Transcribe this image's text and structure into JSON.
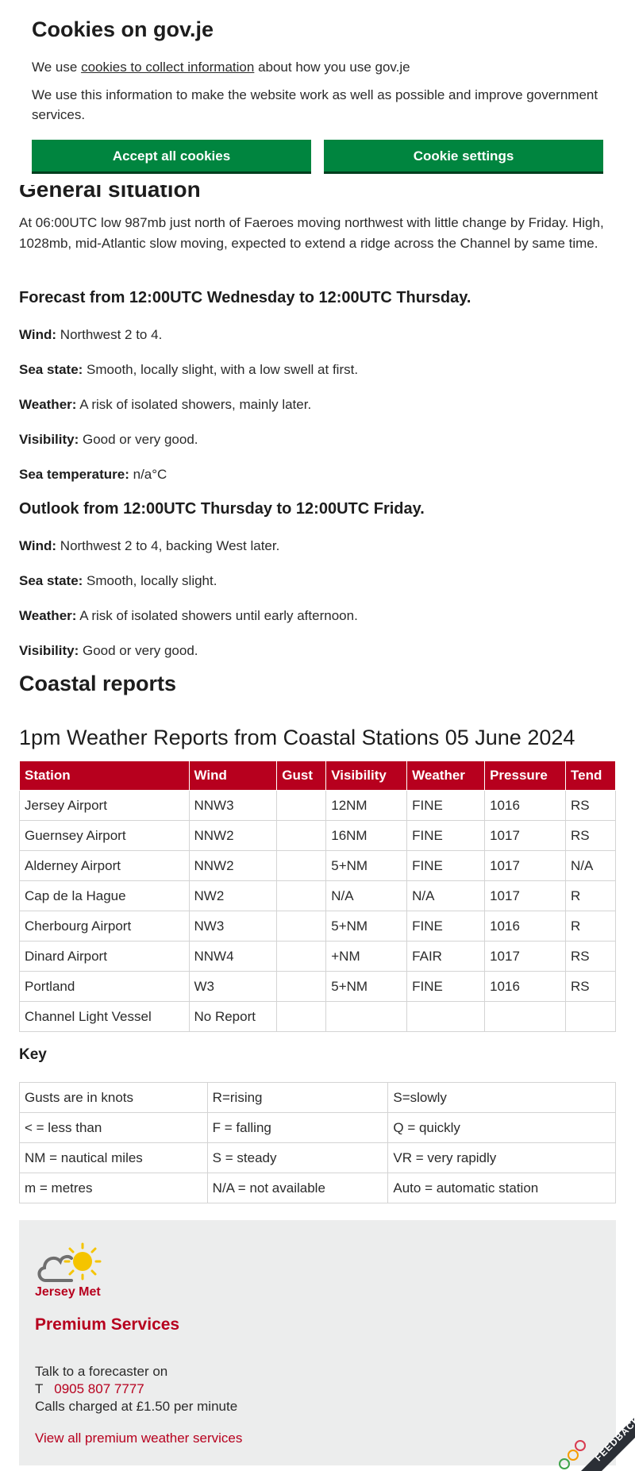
{
  "cookie": {
    "title": "Cookies on gov.je",
    "line1_pre": "We use ",
    "line1_link": "cookies to collect information",
    "line1_post": " about how you use gov.je",
    "line2": "We use this information to make the website work as well as possible and improve government services.",
    "accept_label": "Accept all cookies",
    "settings_label": "Cookie settings"
  },
  "general": {
    "heading": "General situation",
    "text": "At 06:00UTC low 987mb just north of Faeroes moving northwest with little change by Friday. High, 1028mb, mid-Atlantic slow moving, expected to extend a ridge across the Channel by same time."
  },
  "forecast": {
    "heading": "Forecast from 12:00UTC Wednesday to 12:00UTC Thursday.",
    "items": [
      {
        "label": "Wind:",
        "value": " Northwest 2 to 4."
      },
      {
        "label": "Sea state:",
        "value": " Smooth, locally slight, with a low swell at first."
      },
      {
        "label": "Weather:",
        "value": " A risk of isolated showers, mainly later."
      },
      {
        "label": "Visibility:",
        "value": " Good or very good."
      },
      {
        "label": "Sea temperature:",
        "value": " n/a°C"
      }
    ]
  },
  "outlook": {
    "heading": "Outlook from 12:00UTC Thursday to 12:00UTC Friday.",
    "items": [
      {
        "label": "Wind:",
        "value": " Northwest 2 to 4, backing West later."
      },
      {
        "label": "Sea state:",
        "value": " Smooth, locally slight."
      },
      {
        "label": "Weather:",
        "value": " A risk of isolated showers until early afternoon."
      },
      {
        "label": "Visibility:",
        "value": " Good or very good."
      }
    ]
  },
  "coastal": {
    "heading": "Coastal reports",
    "reports_heading": "1pm Weather Reports from Coastal Stations 05 June 2024",
    "columns": [
      "Station",
      "Wind",
      "Gust",
      "Visibility",
      "Weather",
      "Pressure",
      "Tend"
    ],
    "rows": [
      [
        "Jersey Airport",
        "NNW3",
        "",
        "12NM",
        "FINE",
        "1016",
        "RS"
      ],
      [
        "Guernsey Airport",
        "NNW2",
        "",
        "16NM",
        "FINE",
        "1017",
        "RS"
      ],
      [
        "Alderney Airport",
        "NNW2",
        "",
        "5+NM",
        "FINE",
        "1017",
        "N/A"
      ],
      [
        "Cap de la Hague",
        "NW2",
        "",
        "N/A",
        "N/A",
        "1017",
        "R"
      ],
      [
        "Cherbourg Airport",
        "NW3",
        "",
        "5+NM",
        "FINE",
        "1016",
        "R"
      ],
      [
        "Dinard Airport",
        "NNW4",
        "",
        "+NM",
        "FAIR",
        "1017",
        "RS"
      ],
      [
        "Portland",
        "W3",
        "",
        "5+NM",
        "FINE",
        "1016",
        "RS"
      ],
      [
        "Channel Light Vessel",
        "No Report",
        "",
        "",
        "",
        "",
        ""
      ]
    ]
  },
  "key": {
    "title": "Key",
    "rows": [
      [
        "Gusts are in knots",
        "R=rising",
        "S=slowly"
      ],
      [
        "< = less than",
        "F = falling",
        "Q = quickly"
      ],
      [
        "NM = nautical miles",
        "S = steady",
        "VR = very rapidly"
      ],
      [
        "m = metres",
        "N/A = not available",
        "Auto = automatic station"
      ]
    ]
  },
  "premium": {
    "brand": "Jersey Met",
    "title": "Premium Services",
    "talk": "Talk to a forecaster on",
    "phone_prefix": "T",
    "phone": "0905 807 7777",
    "charge": "Calls charged at £1.50 per minute",
    "link": "View all premium weather services"
  },
  "feedback": {
    "label": "FEEDBACK"
  },
  "colors": {
    "brand_red": "#b7001e",
    "button_green": "#00853f",
    "panel_grey": "#eceded"
  }
}
